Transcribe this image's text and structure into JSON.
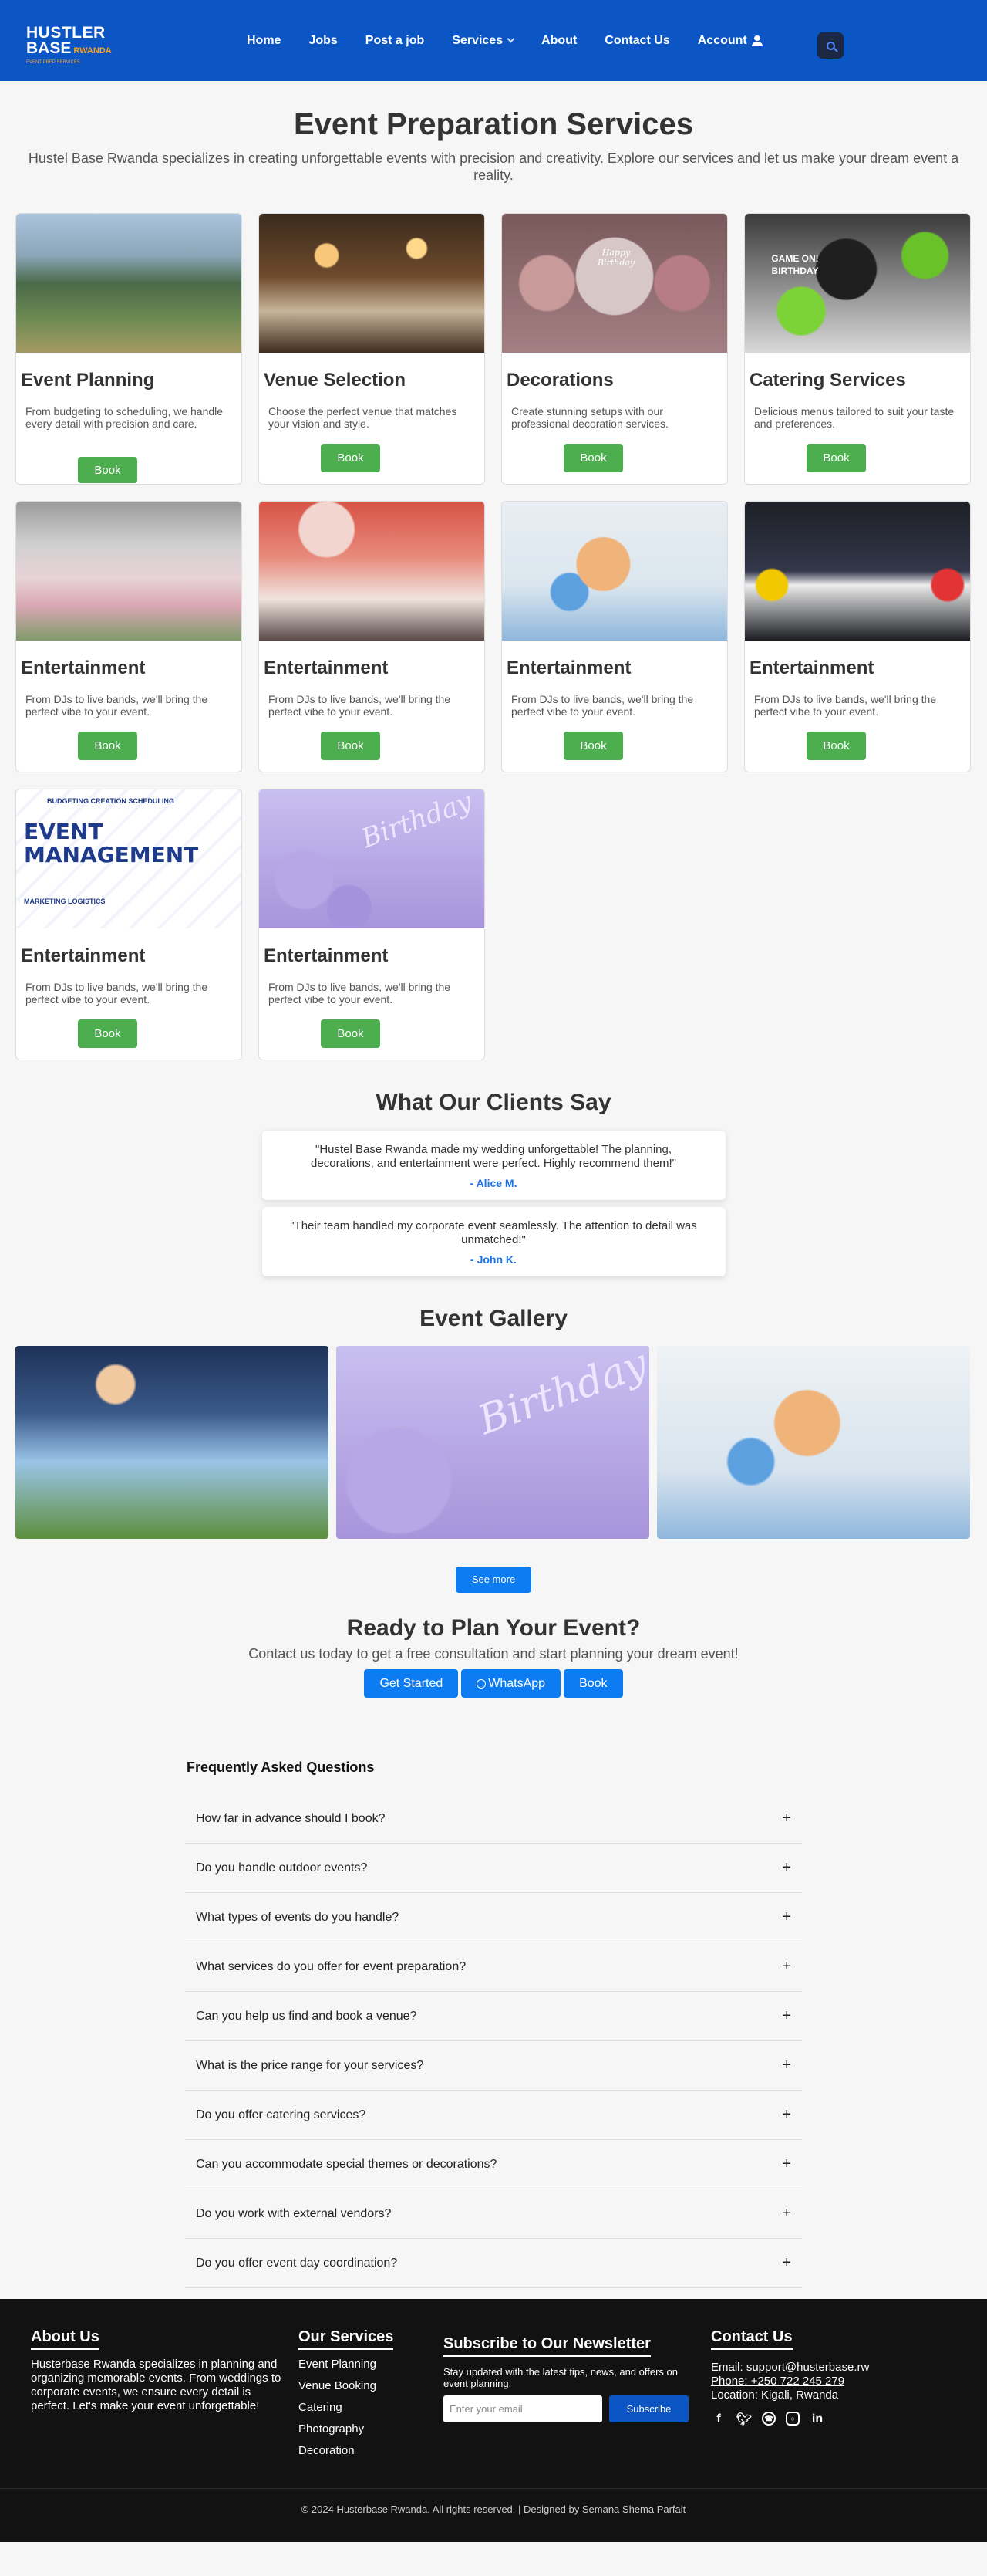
{
  "brand": {
    "line1": "HUSTLER",
    "line2": "BASE",
    "sub": "RWANDA",
    "tagline": "EVENT PREP SERVICES"
  },
  "nav": {
    "home": "Home",
    "jobs": "Jobs",
    "post_job": "Post a job",
    "services": "Services",
    "about": "About",
    "contact": "Contact Us",
    "account": "Account"
  },
  "hero": {
    "title": "Event Preparation Services",
    "subtitle": "Hustel Base Rwanda specializes in creating unforgettable events with precision and creativity. Explore our services and let us make your dream event a reality."
  },
  "services": [
    {
      "title": "Event Planning",
      "desc": "From budgeting to scheduling, we handle every detail with precision and care.",
      "button": "Book"
    },
    {
      "title": "Venue Selection",
      "desc": "Choose the perfect venue that matches your vision and style.",
      "button": "Book"
    },
    {
      "title": "Decorations",
      "desc": "Create stunning setups with our professional decoration services.",
      "button": "Book",
      "image_text": "Happy Birthday"
    },
    {
      "title": "Catering Services",
      "desc": "Delicious menus tailored to suit your taste and preferences.",
      "button": "Book",
      "image_text": "GAME ON! BIRTHDAY"
    },
    {
      "title": "Entertainment",
      "desc": "From DJs to live bands, we'll bring the perfect vibe to your event.",
      "button": "Book"
    },
    {
      "title": "Entertainment",
      "desc": "From DJs to live bands, we'll bring the perfect vibe to your event.",
      "button": "Book"
    },
    {
      "title": "Entertainment",
      "desc": "From DJs to live bands, we'll bring the perfect vibe to your event.",
      "button": "Book"
    },
    {
      "title": "Entertainment",
      "desc": "From DJs to live bands, we'll bring the perfect vibe to your event.",
      "button": "Book"
    },
    {
      "title": "Entertainment",
      "desc": "From DJs to live bands, we'll bring the perfect vibe to your event.",
      "button": "Book",
      "image_text": [
        "EVENT",
        "MANAGEMENT",
        "BUDGETING CREATION SCHEDULING",
        "MARKETING LOGISTICS"
      ]
    },
    {
      "title": "Entertainment",
      "desc": "From DJs to live bands, we'll bring the perfect vibe to your event.",
      "button": "Book",
      "image_text": "Birthday"
    }
  ],
  "testimonials": {
    "title": "What Our Clients Say",
    "items": [
      {
        "quote": "\"Hustel Base Rwanda made my wedding unforgettable! The planning, decorations, and entertainment were perfect. Highly recommend them!\"",
        "author": "- Alice M."
      },
      {
        "quote": "\"Their team handled my corporate event seamlessly. The attention to detail was unmatched!\"",
        "author": "- John K."
      }
    ]
  },
  "gallery": {
    "title": "Event Gallery",
    "see_more": "See more",
    "image_text": "Birthday"
  },
  "cta": {
    "title": "Ready to Plan Your Event?",
    "subtitle": "Contact us today to get a free consultation and start planning your dream event!",
    "get_started": "Get Started",
    "whatsapp": "WhatsApp",
    "book": "Book"
  },
  "faq": {
    "title": "Frequently Asked Questions",
    "items": [
      "How far in advance should I book?",
      "Do you handle outdoor events?",
      "What types of events do you handle?",
      "What services do you offer for event preparation?",
      "Can you help us find and book a venue?",
      "What is the price range for your services?",
      "Do you offer catering services?",
      "Can you accommodate special themes or decorations?",
      "Do you work with external vendors?",
      "Do you offer event day coordination?"
    ],
    "toggle": "+"
  },
  "footer": {
    "about_title": "About Us",
    "about_text": "Husterbase Rwanda specializes in planning and organizing memorable events. From weddings to corporate events, we ensure every detail is perfect. Let's make your event unforgettable!",
    "services_title": "Our Services",
    "services": [
      "Event Planning",
      "Venue Booking",
      "Catering",
      "Photography",
      "Decoration"
    ],
    "newsletter_title": "Subscribe to Our Newsletter",
    "newsletter_text": "Stay updated with the latest tips, news, and offers on event planning.",
    "email_placeholder": "Enter your email",
    "subscribe": "Subscribe",
    "contact_title": "Contact Us",
    "email": "Email: support@husterbase.rw",
    "phone": "Phone: +250 722 245 279",
    "location": "Location: Kigali, Rwanda",
    "copyright": "© 2024 Husterbase Rwanda. All rights reserved. | Designed by Semana Shema Parfait"
  }
}
